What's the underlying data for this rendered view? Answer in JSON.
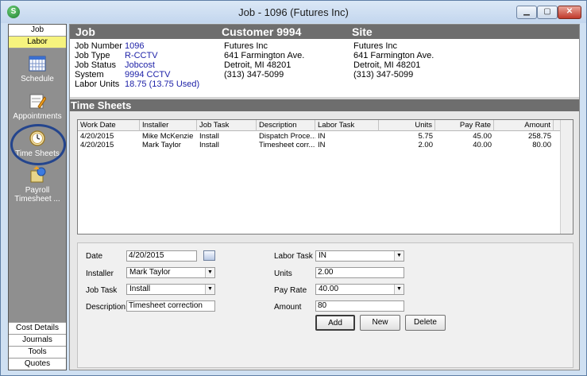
{
  "window": {
    "title": "Job - 1096 (Futures  Inc)",
    "app_icon_letter": "S"
  },
  "sidebar": {
    "top_tabs": [
      {
        "label": "Job"
      },
      {
        "label": "Labor"
      }
    ],
    "items": [
      {
        "label": "Schedule",
        "icon": "calendar-icon"
      },
      {
        "label": "Appointments",
        "icon": "appointment-icon"
      },
      {
        "label": "Time Sheets",
        "icon": "clock-icon"
      },
      {
        "label": "Payroll\nTimesheet ...",
        "icon": "payroll-icon"
      }
    ],
    "bottom_tabs": [
      {
        "label": "Cost Details"
      },
      {
        "label": "Journals"
      },
      {
        "label": "Tools"
      },
      {
        "label": "Quotes"
      }
    ]
  },
  "header": {
    "job_title": "Job",
    "customer_title": "Customer 9994",
    "site_title": "Site"
  },
  "job": {
    "labels": [
      "Job Number",
      "Job Type",
      "Job Status",
      "System",
      "Labor Units"
    ],
    "values": [
      "1096",
      "R-CCTV",
      "Jobcost",
      "9994 CCTV",
      "18.75 (13.75 Used)"
    ]
  },
  "customer": {
    "name": "Futures  Inc",
    "address": "641 Farmington Ave.",
    "city": "Detroit, MI  48201",
    "phone": "(313) 347-5099"
  },
  "site": {
    "name": "Futures  Inc",
    "address": "641 Farmington Ave.",
    "city": "Detroit, MI  48201",
    "phone": "(313) 347-5099"
  },
  "timesheets": {
    "section_title": "Time Sheets",
    "columns": [
      "Work Date",
      "Installer",
      "Job Task",
      "Description",
      "Labor Task",
      "Units",
      "Pay Rate",
      "Amount"
    ],
    "rows": [
      [
        "4/20/2015",
        "Mike McKenzie",
        "Install",
        "Dispatch Proce...",
        "IN",
        "5.75",
        "45.00",
        "258.75"
      ],
      [
        "4/20/2015",
        "Mark Taylor",
        "Install",
        "Timesheet corr...",
        "IN",
        "2.00",
        "40.00",
        "80.00"
      ]
    ]
  },
  "form": {
    "date_label": "Date",
    "date_value": "4/20/2015",
    "installer_label": "Installer",
    "installer_value": "Mark Taylor",
    "jobtask_label": "Job Task",
    "jobtask_value": "Install",
    "description_label": "Description",
    "description_value": "Timesheet correction",
    "labortask_label": "Labor Task",
    "labortask_value": "IN",
    "units_label": "Units",
    "units_value": "2.00",
    "payrate_label": "Pay Rate",
    "payrate_value": "40.00",
    "amount_label": "Amount",
    "amount_value": "80",
    "add_label": "Add",
    "new_label": "New",
    "delete_label": "Delete"
  }
}
